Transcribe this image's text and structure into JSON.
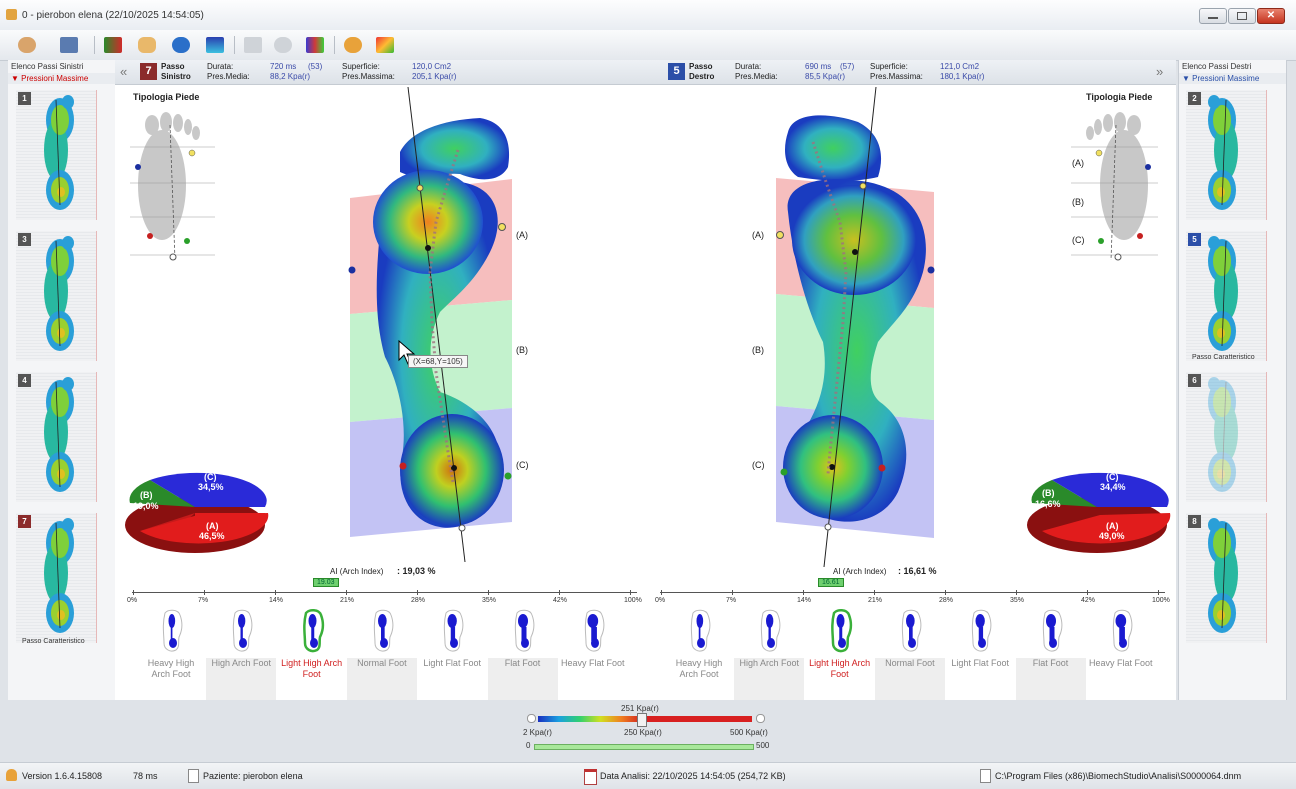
{
  "window": {
    "title": "0 - pierobon elena  (22/10/2025 14:54:05)"
  },
  "left_panel": {
    "header": "Elenco Passi Sinistri",
    "subheader": "▼ Pressioni Massime",
    "thumbs": [
      {
        "num": "1",
        "caption": ""
      },
      {
        "num": "3",
        "caption": ""
      },
      {
        "num": "4",
        "caption": ""
      },
      {
        "num": "7",
        "caption": "Passo Caratteristico"
      }
    ]
  },
  "right_panel": {
    "header": "Elenco Passi Destri",
    "subheader": "▼ Pressioni Massime",
    "thumbs": [
      {
        "num": "2",
        "caption": ""
      },
      {
        "num": "5",
        "caption": "Passo Caratteristico"
      },
      {
        "num": "6",
        "caption": ""
      },
      {
        "num": "8",
        "caption": ""
      }
    ],
    "footer": "(...)"
  },
  "left_footer": "(...)",
  "left_step": {
    "badge": "7",
    "passo": "Passo",
    "side": "Sinistro",
    "durata_label": "Durata:",
    "durata_value": "720 ms",
    "durata_count": "(53)",
    "pres_media_label": "Pres.Media:",
    "pres_media_value": "88,2 Kpa(r)",
    "superficie_label": "Superficie:",
    "superficie_value": "120,0 Cm2",
    "pres_massima_label": "Pres.Massima:",
    "pres_massima_value": "205,1 Kpa(r)"
  },
  "right_step": {
    "badge": "5",
    "passo": "Passo",
    "side": "Destro",
    "durata_label": "Durata:",
    "durata_value": "690 ms",
    "durata_count": "(57)",
    "pres_media_label": "Pres.Media:",
    "pres_media_value": "85,5 Kpa(r)",
    "superficie_label": "Superficie:",
    "superficie_value": "121,0 Cm2",
    "pres_massima_label": "Pres.Massima:",
    "pres_massima_value": "180,1 Kpa(r)"
  },
  "tipologia": "Tipologia Piede",
  "zones": {
    "a": "(A)",
    "b": "(B)",
    "c": "(C)"
  },
  "tooltip": "(X=68,Y=105)",
  "left_pie": {
    "a": "(A)",
    "a_val": "46,5%",
    "b": "(B)",
    "b_val": "19,0%",
    "c": "(C)",
    "c_val": "34,5%"
  },
  "right_pie": {
    "a": "(A)",
    "a_val": "49,0%",
    "b": "(B)",
    "b_val": "16,6%",
    "c": "(C)",
    "c_val": "34,4%"
  },
  "left_arch": {
    "label": "AI (Arch Index)",
    "value": ": 19,03 %",
    "marker": "19.03"
  },
  "right_arch": {
    "label": "AI (Arch Index)",
    "value": ": 16,61 %",
    "marker": "16.61"
  },
  "scale_ticks": [
    "0%",
    "7%",
    "14%",
    "21%",
    "28%",
    "35%",
    "42%",
    "100%"
  ],
  "foot_types": [
    {
      "line1": "Heavy High",
      "line2": "Arch Foot"
    },
    {
      "line1": "High Arch Foot",
      "line2": ""
    },
    {
      "line1": "Light High Arch",
      "line2": "Foot"
    },
    {
      "line1": "Normal Foot",
      "line2": ""
    },
    {
      "line1": "Light Flat Foot",
      "line2": ""
    },
    {
      "line1": "Flat Foot",
      "line2": ""
    },
    {
      "line1": "Heavy Flat Foot",
      "line2": ""
    }
  ],
  "selected_foot_type_index": 2,
  "pressure_scale": {
    "current": "251 Kpa(r)",
    "min_label": "2 Kpa(r)",
    "mid_label": "250 Kpa(r)",
    "max_label": "500 Kpa(r)",
    "range_min": "0",
    "range_max": "500",
    "current_fraction": 0.5
  },
  "status": {
    "version": "Version 1.6.4.15808",
    "ms": "78 ms",
    "patient": "Paziente: pierobon  elena",
    "date": "Data Analisi: 22/10/2025 14:54:05  (254,72 KB)",
    "path": "C:\\Program Files (x86)\\BiomechStudio\\Analisi\\S0000064.dnm"
  },
  "colors": {
    "zone_a": "#f4b3b3",
    "zone_b": "#b8f0c4",
    "zone_c": "#b9b9f2",
    "pie_a": "#e11c1c",
    "pie_b": "#2a8a2a",
    "pie_c": "#2a2ad8",
    "badge_left": "#8b2b2b",
    "badge_right": "#2c4fa8"
  }
}
